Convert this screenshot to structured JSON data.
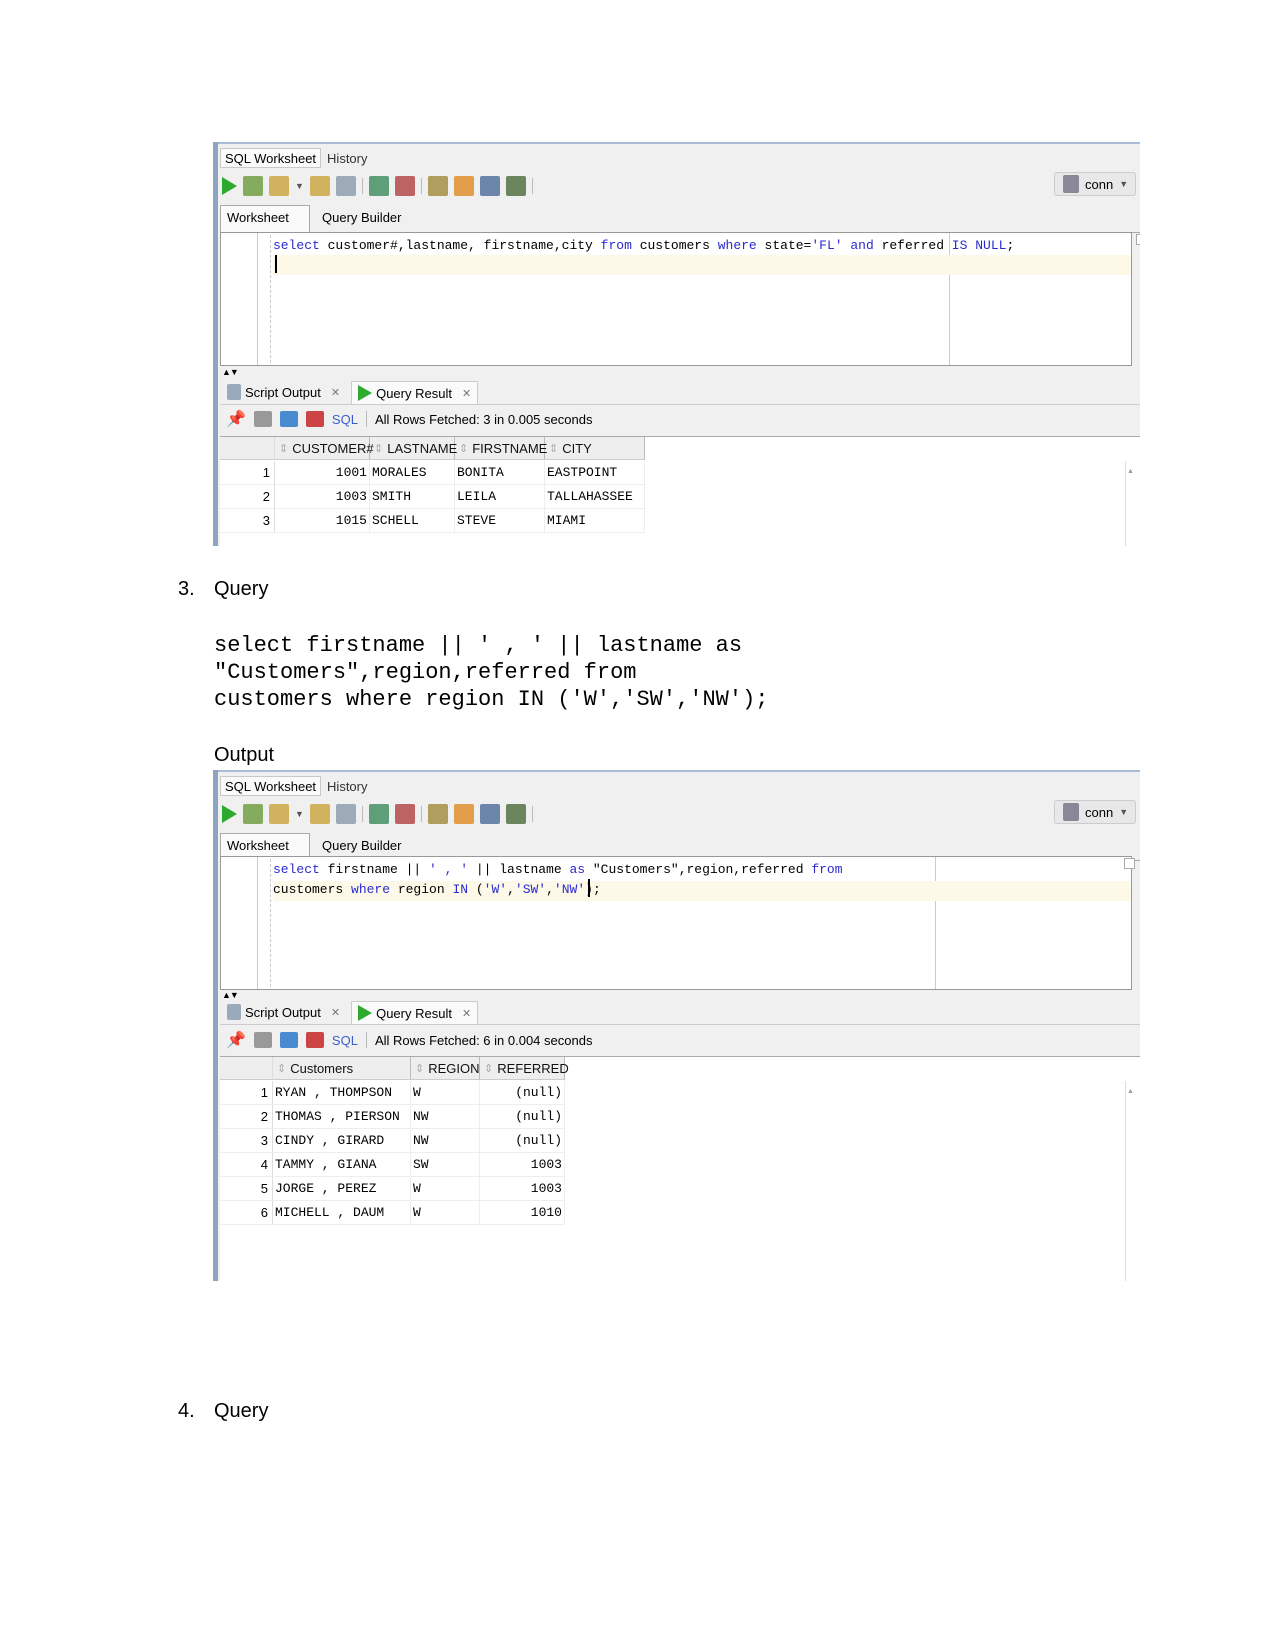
{
  "colors": {
    "keyword": "#2a2ad0",
    "panel_bg": "#f0f0f0",
    "accent_border": "#8ea4c1"
  },
  "doc": {
    "item3_number": "3.",
    "item3_label": "Query",
    "query3_lines": [
      "select firstname || ' , ' || lastname as",
      "\"Customers\",region,referred from",
      "customers where region IN ('W','SW','NW');"
    ],
    "output_label": "Output",
    "item4_number": "4.",
    "item4_label": "Query"
  },
  "panels": [
    {
      "tabs": [
        "SQL Worksheet",
        "History"
      ],
      "conn_label": "conn",
      "subtabs": [
        "Worksheet",
        "Query Builder"
      ],
      "code": [
        [
          {
            "t": "select",
            "k": "kw"
          },
          {
            "t": " customer#,lastname, firstname,city ",
            "k": ""
          },
          {
            "t": "from",
            "k": "kw"
          },
          {
            "t": " customers ",
            "k": ""
          },
          {
            "t": "where",
            "k": "kw"
          },
          {
            "t": " state=",
            "k": ""
          },
          {
            "t": "'FL'",
            "k": "str"
          },
          {
            "t": " ",
            "k": ""
          },
          {
            "t": "and",
            "k": "kw"
          },
          {
            "t": " referred ",
            "k": ""
          },
          {
            "t": "IS",
            "k": "kw"
          },
          {
            "t": " ",
            "k": ""
          },
          {
            "t": "NULL",
            "k": "kw"
          },
          {
            "t": ";",
            "k": ""
          }
        ]
      ],
      "result_tabs": [
        "Script Output",
        "Query Result"
      ],
      "sql_label": "SQL",
      "status": "All Rows Fetched: 3 in 0.005 seconds",
      "columns": [
        "CUSTOMER#",
        "LASTNAME",
        "FIRSTNAME",
        "CITY"
      ],
      "rows": [
        [
          "1",
          "1001",
          "MORALES",
          "BONITA",
          "EASTPOINT"
        ],
        [
          "2",
          "1003",
          "SMITH",
          "LEILA",
          "TALLAHASSEE"
        ],
        [
          "3",
          "1015",
          "SCHELL",
          "STEVE",
          "MIAMI"
        ]
      ]
    },
    {
      "tabs": [
        "SQL Worksheet",
        "History"
      ],
      "conn_label": "conn",
      "subtabs": [
        "Worksheet",
        "Query Builder"
      ],
      "code": [
        [
          {
            "t": "select",
            "k": "kw"
          },
          {
            "t": " firstname || ",
            "k": ""
          },
          {
            "t": "' , '",
            "k": "str"
          },
          {
            "t": " || lastname ",
            "k": ""
          },
          {
            "t": "as",
            "k": "kw"
          },
          {
            "t": " \"Customers\",region,referred ",
            "k": ""
          },
          {
            "t": "from",
            "k": "kw"
          }
        ],
        [
          {
            "t": "customers ",
            "k": ""
          },
          {
            "t": "where",
            "k": "kw"
          },
          {
            "t": " region ",
            "k": ""
          },
          {
            "t": "IN",
            "k": "kw"
          },
          {
            "t": " (",
            "k": ""
          },
          {
            "t": "'W'",
            "k": "str"
          },
          {
            "t": ",",
            "k": ""
          },
          {
            "t": "'SW'",
            "k": "str"
          },
          {
            "t": ",",
            "k": ""
          },
          {
            "t": "'NW'",
            "k": "str"
          },
          {
            "t": ");",
            "k": ""
          }
        ]
      ],
      "result_tabs": [
        "Script Output",
        "Query Result"
      ],
      "sql_label": "SQL",
      "status": "All Rows Fetched: 6 in 0.004 seconds",
      "columns": [
        "Customers",
        "REGION",
        "REFERRED"
      ],
      "rows": [
        [
          "1",
          "RYAN , THOMPSON",
          "W",
          "(null)"
        ],
        [
          "2",
          "THOMAS , PIERSON",
          "NW",
          "(null)"
        ],
        [
          "3",
          "CINDY , GIRARD",
          "NW",
          "(null)"
        ],
        [
          "4",
          "TAMMY , GIANA",
          "SW",
          "1003"
        ],
        [
          "5",
          "JORGE , PEREZ",
          "W",
          "1003"
        ],
        [
          "6",
          "MICHELL , DAUM",
          "W",
          "1010"
        ]
      ]
    }
  ]
}
